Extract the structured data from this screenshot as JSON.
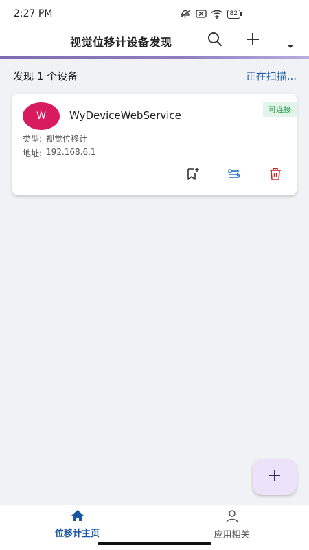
{
  "status_bar": {
    "time": "2:27 PM",
    "battery": "82",
    "icons": [
      "mute-icon",
      "sim-off-icon",
      "wifi-icon",
      "battery-icon"
    ]
  },
  "app_bar": {
    "title": "视觉位移计设备发现",
    "actions": [
      "search-icon",
      "add-icon",
      "dropdown-icon"
    ],
    "accent_color": "#7c6bb0"
  },
  "summary": {
    "found_text": "发现 1 个设备",
    "scanning_text": "正在扫描..."
  },
  "devices": [
    {
      "avatar_letter": "W",
      "avatar_color": "#d81b5e",
      "name": "WyDeviceWebService",
      "status_badge": "可连接",
      "type_label": "类型:",
      "type_value": "视觉位移计",
      "address_label": "地址:",
      "address_value": "192.168.6.1",
      "actions": [
        "bookmark-add-icon",
        "connect-icon",
        "delete-icon"
      ]
    }
  ],
  "fab": {
    "icon": "add-icon"
  },
  "bottom_nav": {
    "items": [
      {
        "label": "位移计主页",
        "icon": "home-icon",
        "active": true
      },
      {
        "label": "应用相关",
        "icon": "person-icon",
        "active": false
      }
    ]
  }
}
